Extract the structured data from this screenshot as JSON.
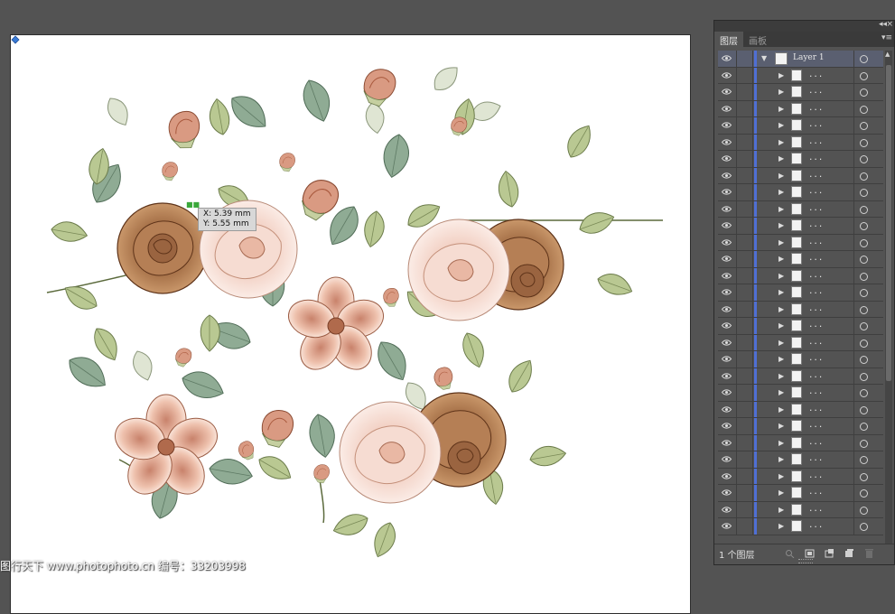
{
  "tooltip": {
    "x_label": "X: 5.39 mm",
    "y_label": "Y: 5.55 mm"
  },
  "watermark": {
    "text": "图行天下 www.photophoto.cn 编号：33203998"
  },
  "layers_panel": {
    "tabs": [
      {
        "label": "图层",
        "active": true
      },
      {
        "label": "画板",
        "active": false
      }
    ],
    "top_layer": {
      "name": "Layer 1",
      "expanded": true
    },
    "sublayer_name": "...",
    "sublayer_count": 28,
    "footer": {
      "layer_count_text": "1 个图层"
    },
    "colors": {
      "layer_color": "#4f6fd4",
      "panel_bg": "#535353"
    }
  }
}
